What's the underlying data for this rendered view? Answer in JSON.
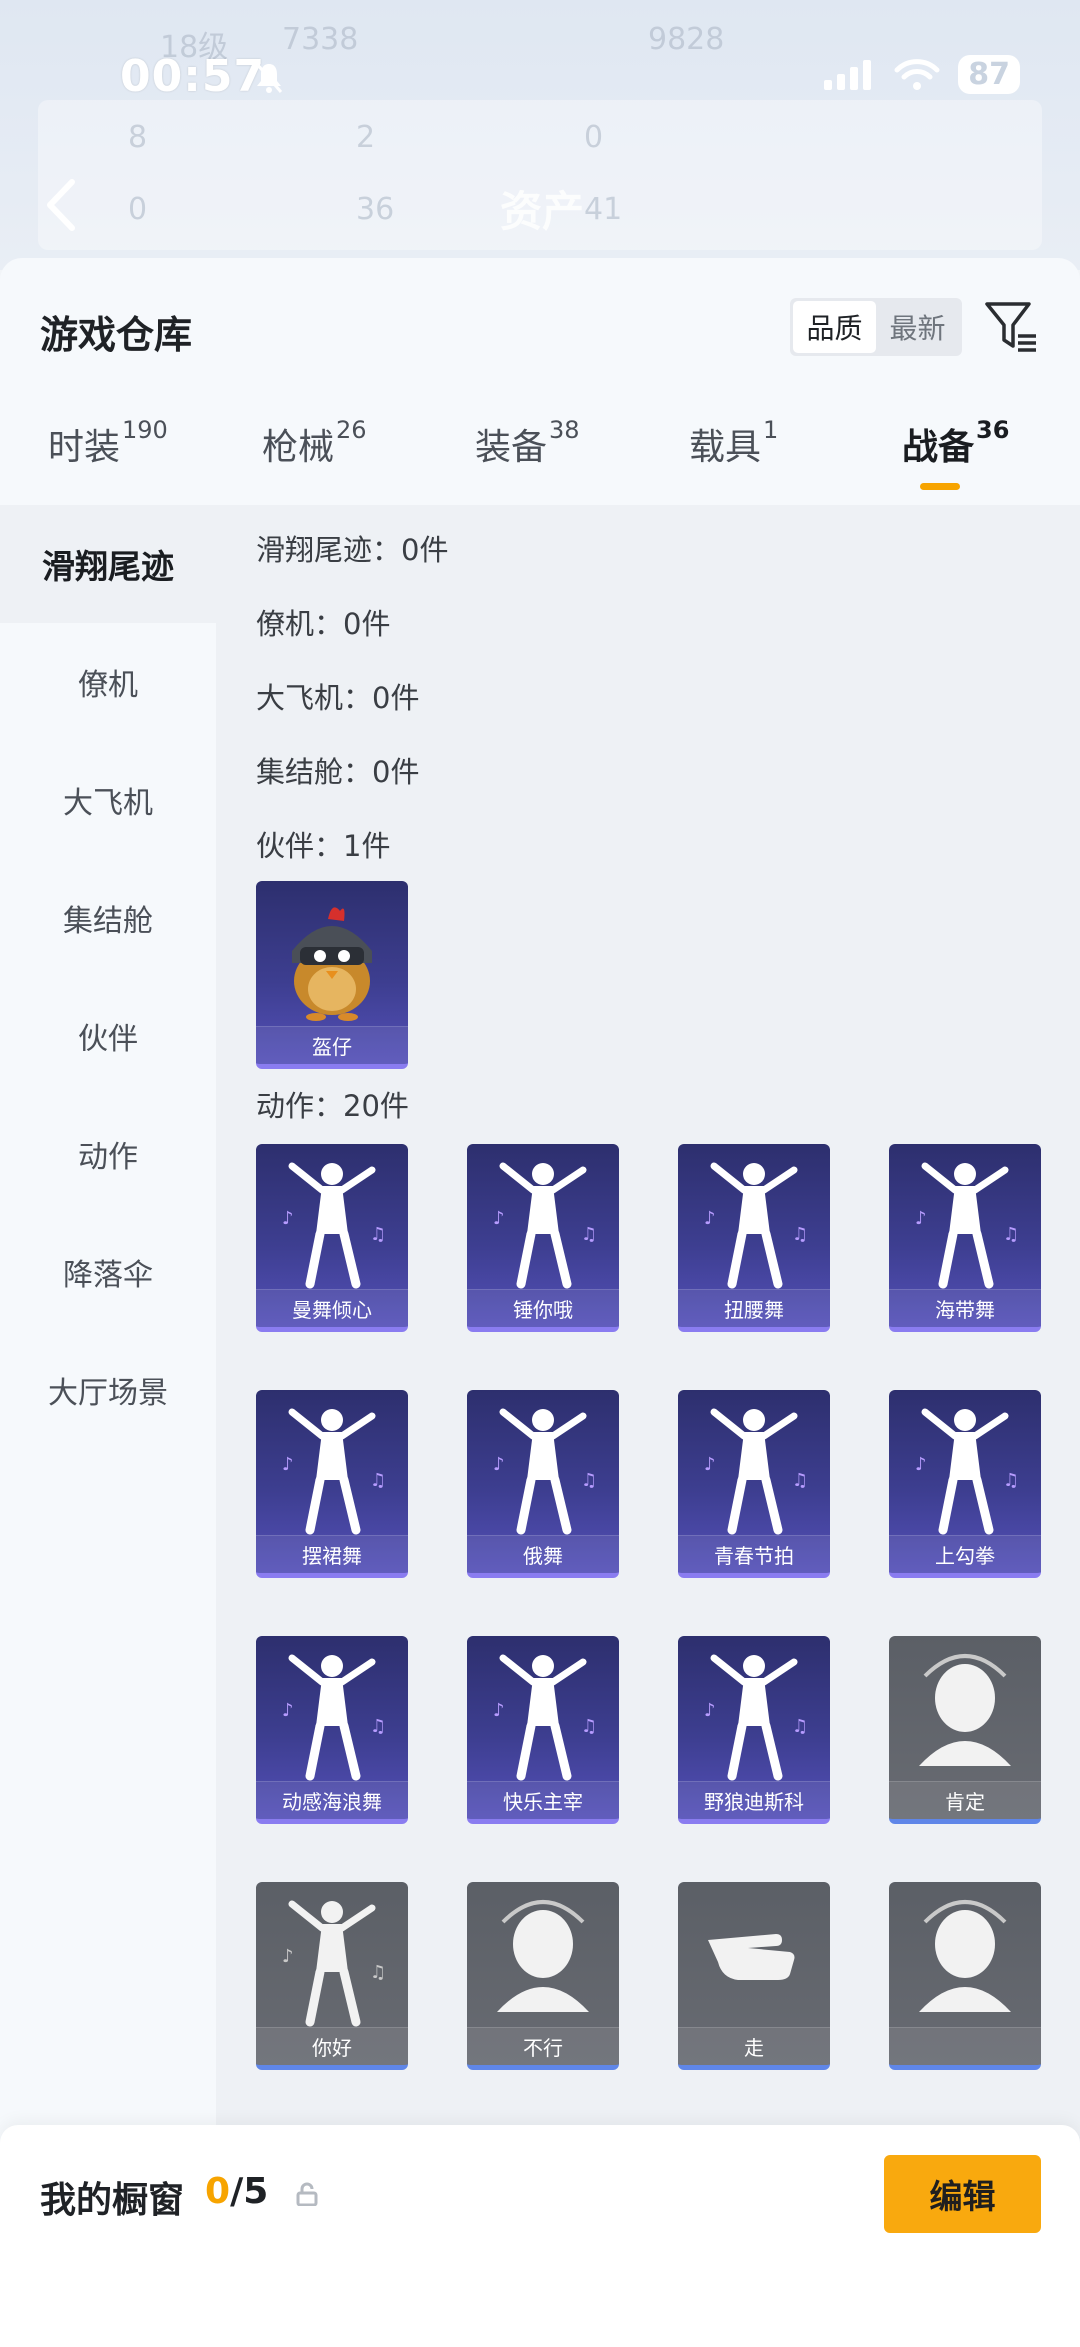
{
  "status_bar": {
    "time": "00:57",
    "battery": "87"
  },
  "header": {
    "title": "资产",
    "faded_level": "18级",
    "faded_fans": "7338",
    "faded_likes": "9828",
    "faded_stats": [
      "8",
      "2",
      "0",
      "0",
      "36",
      "41"
    ]
  },
  "warehouse": {
    "title": "游戏仓库",
    "sort": {
      "options": [
        "品质",
        "最新"
      ],
      "selected": "品质"
    }
  },
  "tabs": [
    {
      "label": "时装",
      "count": "190"
    },
    {
      "label": "枪械",
      "count": "26"
    },
    {
      "label": "装备",
      "count": "38"
    },
    {
      "label": "载具",
      "count": "1"
    },
    {
      "label": "战备",
      "count": "36"
    }
  ],
  "active_tab": "战备",
  "sidebar": [
    {
      "label": "滑翔尾迹"
    },
    {
      "label": "僚机"
    },
    {
      "label": "大飞机"
    },
    {
      "label": "集结舱"
    },
    {
      "label": "伙伴"
    },
    {
      "label": "动作"
    },
    {
      "label": "降落伞"
    },
    {
      "label": "大厅场景"
    }
  ],
  "sections": [
    {
      "label": "滑翔尾迹：0件"
    },
    {
      "label": "僚机：0件"
    },
    {
      "label": "大飞机：0件"
    },
    {
      "label": "集结舱：0件"
    },
    {
      "label": "伙伴：1件"
    },
    {
      "label": "动作：20件"
    }
  ],
  "partner_items": [
    {
      "name": "盔仔",
      "style": "purple",
      "icon": "helmet-chick-icon"
    }
  ],
  "action_items": [
    {
      "name": "曼舞倾心",
      "style": "purple",
      "icon": "dancer-sparkle-icon"
    },
    {
      "name": "锤你哦",
      "style": "purple",
      "icon": "hammer-dancer-icon"
    },
    {
      "name": "扭腰舞",
      "style": "purple",
      "icon": "twist-dancer-icon"
    },
    {
      "name": "海带舞",
      "style": "purple",
      "icon": "seaweed-dancer-icon"
    },
    {
      "name": "摆裙舞",
      "style": "purple",
      "icon": "skirt-dancer-icon"
    },
    {
      "name": "俄舞",
      "style": "purple",
      "icon": "russian-dancer-icon"
    },
    {
      "name": "青春节拍",
      "style": "purple",
      "icon": "youth-beat-icon"
    },
    {
      "name": "上勾拳",
      "style": "purple",
      "icon": "uppercut-icon"
    },
    {
      "name": "动感海浪舞",
      "style": "purple",
      "icon": "wave-dancer-icon"
    },
    {
      "name": "快乐主宰",
      "style": "purple",
      "icon": "joy-dancer-icon"
    },
    {
      "name": "野狼迪斯科",
      "style": "purple",
      "icon": "disco-dancer-icon"
    },
    {
      "name": "肯定",
      "style": "gray",
      "icon": "nod-head-icon"
    },
    {
      "name": "你好",
      "style": "gray",
      "icon": "wave-hand-icon"
    },
    {
      "name": "不行",
      "style": "gray",
      "icon": "shake-head-icon"
    },
    {
      "name": "走",
      "style": "gray",
      "icon": "pointing-hand-icon"
    },
    {
      "name": "",
      "style": "gray",
      "icon": "helmet-icon"
    }
  ],
  "showcase": {
    "title": "我的橱窗",
    "current": "0",
    "total": "/5",
    "edit_label": "编辑"
  },
  "colors": {
    "accent": "#f7a400",
    "card_purple": "#3d3e90",
    "card_gray": "#686b72"
  }
}
